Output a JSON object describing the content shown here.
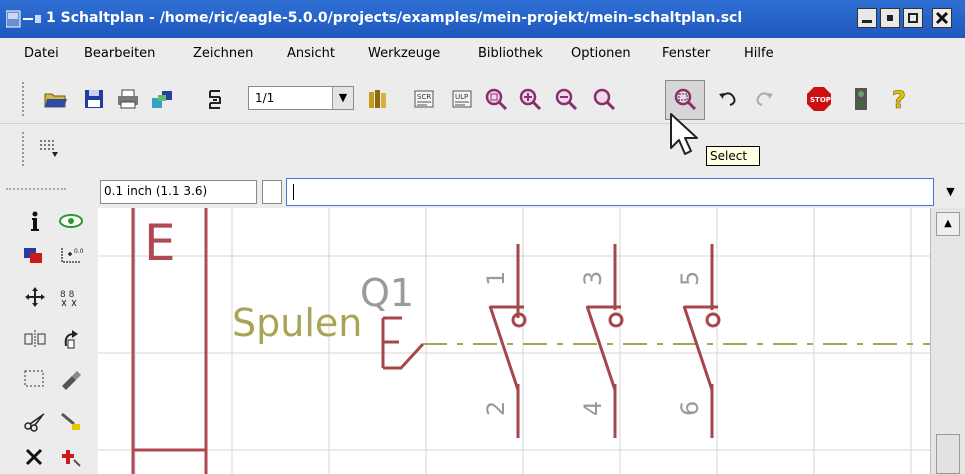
{
  "window": {
    "title": "1 Schaltplan - /home/ric/eagle-5.0.0/projects/examples/mein-projekt/mein-schaltplan.scl",
    "controls": [
      "minimize-icon",
      "maximize-icon",
      "restore-icon",
      "close-icon"
    ]
  },
  "menu": {
    "items": [
      "Datei",
      "Bearbeiten",
      "Zeichnen",
      "Ansicht",
      "Werkzeuge",
      "Bibliothek",
      "Optionen",
      "Fenster",
      "Hilfe"
    ]
  },
  "toolbar": {
    "icons": [
      "open-icon",
      "save-icon",
      "print-icon",
      "cam-icon",
      "sheet-icon",
      "library-icon",
      "script-icon",
      "ulp-icon",
      "zoom-fit-icon",
      "zoom-in-icon",
      "zoom-out-icon",
      "redraw-icon",
      "zoom-select-icon",
      "undo-icon",
      "redo-icon",
      "stop-icon",
      "go-icon",
      "help-icon"
    ],
    "zoom_value": "1/1",
    "tooltip": "Select"
  },
  "command": {
    "coordinates": "0.1 inch (1.1 3.6)",
    "value": ""
  },
  "palette": {
    "icons": [
      "info-icon",
      "show-icon",
      "display-icon",
      "mark-icon",
      "move-icon",
      "copy-icon",
      "mirror-icon",
      "rotate-icon",
      "group-icon",
      "change-icon",
      "cut-icon",
      "paste-icon",
      "delete-icon",
      "add-icon"
    ]
  },
  "canvas": {
    "labels": {
      "frame_letter": "E",
      "part_name": "Q1",
      "net_label": "Spulen",
      "pin_top": [
        "1",
        "3",
        "5"
      ],
      "pin_bottom": [
        "2",
        "4",
        "6"
      ]
    },
    "colors": {
      "grid": "#cfcfcf",
      "symbol": "#a5474a",
      "text_gray": "#9a9a9a",
      "net_olive": "#a9a455",
      "frame": "#b04a52"
    }
  }
}
